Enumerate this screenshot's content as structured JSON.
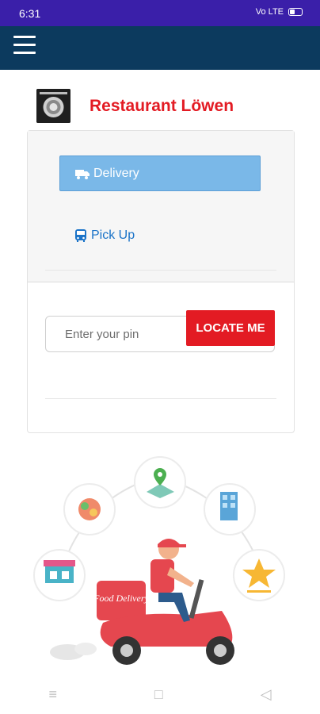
{
  "status_bar": {
    "time": "6:31",
    "signal_text": "Vo LTE",
    "battery_icon": "battery-icon"
  },
  "app_bar": {
    "menu_icon": "hamburger-icon"
  },
  "restaurant": {
    "name": "Restaurant Löwen",
    "logo_icon": "restaurant-logo"
  },
  "order_type": {
    "delivery_label": "Delivery",
    "pickup_label": "Pick Up",
    "delivery_icon": "truck-icon",
    "pickup_icon": "bus-icon"
  },
  "pin": {
    "placeholder": "Enter your pin",
    "value": "",
    "locate_label": "LOCATE ME"
  },
  "illustration": {
    "badge_text": "Food Delivery"
  },
  "nav": {
    "menu": "≡",
    "home": "□",
    "back": "◁"
  },
  "colors": {
    "brand_red": "#e31b23",
    "app_bar": "#0c3a5e",
    "status_bar": "#3a1fa9",
    "delivery_bg": "#7ab8e8",
    "link_blue": "#1a73c8"
  }
}
